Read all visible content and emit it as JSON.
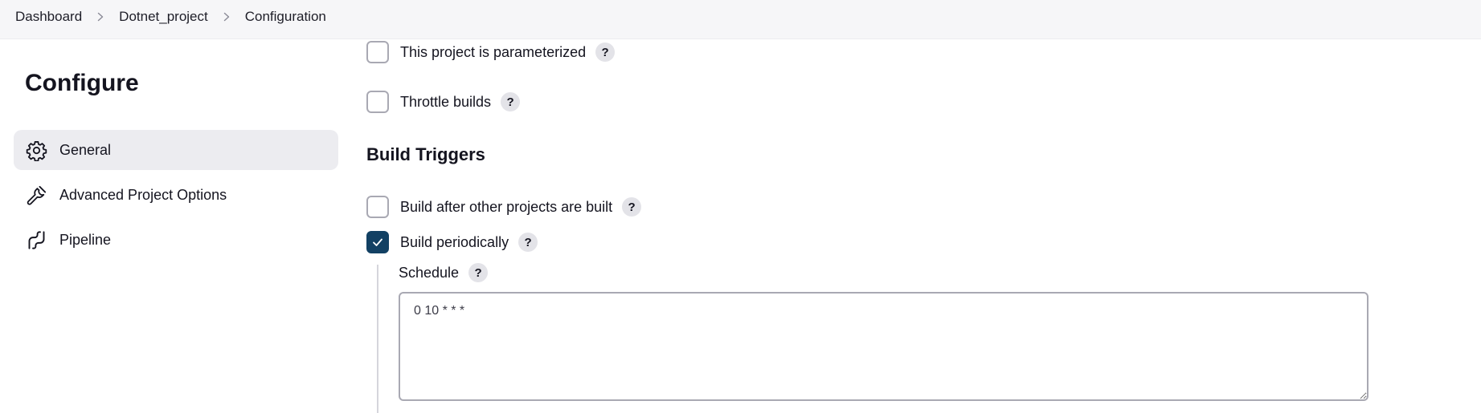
{
  "breadcrumb": {
    "items": [
      "Dashboard",
      "Dotnet_project",
      "Configuration"
    ],
    "separator_icon": "chevron-right-icon"
  },
  "sidebar": {
    "title": "Configure",
    "items": [
      {
        "label": "General",
        "icon": "gear-icon",
        "active": true
      },
      {
        "label": "Advanced Project Options",
        "icon": "wrench-icon",
        "active": false
      },
      {
        "label": "Pipeline",
        "icon": "pipeline-icon",
        "active": false
      }
    ]
  },
  "general": {
    "parameterized_label": "This project is parameterized",
    "parameterized_checked": false,
    "throttle_label": "Throttle builds",
    "throttle_checked": false
  },
  "build_triggers": {
    "title": "Build Triggers",
    "after_other_label": "Build after other projects are built",
    "after_other_checked": false,
    "periodically_label": "Build periodically",
    "periodically_checked": true,
    "schedule": {
      "label": "Schedule",
      "value": "0 10 * * *"
    }
  },
  "help_label": "?",
  "colors": {
    "accent": "#124063",
    "topbar_bg": "#f6f6f8",
    "active_item_bg": "#ececf0",
    "help_bg": "#e3e3e8"
  }
}
